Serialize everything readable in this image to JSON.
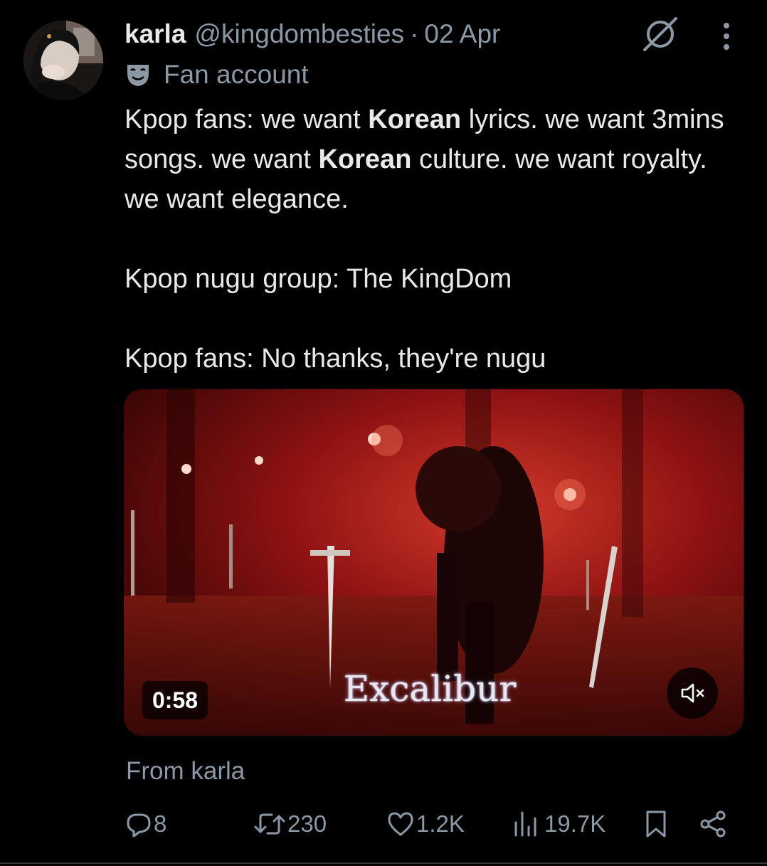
{
  "author": {
    "name": "karla",
    "handle": "@kingdombesties",
    "separator": "·",
    "date": "02 Apr",
    "label": "Fan account"
  },
  "tweet": {
    "line1_a": "Kpop fans: we want ",
    "line1_bold": "Korean",
    "line1_b": " lyrics. we want 3mins songs. we want ",
    "line1_bold2": "Korean",
    "line1_c": " culture. we want royalty. we want elegance.",
    "line2": "Kpop nugu group: The KingDom",
    "line3": "Kpop fans: No thanks, they're nugu"
  },
  "media": {
    "duration": "0:58",
    "caption": "Excalibur",
    "mute_icon": "speaker-muted-icon"
  },
  "from_text": "From karla",
  "actions": {
    "replies": "8",
    "reposts": "230",
    "likes": "1.2K",
    "views": "19.7K"
  },
  "colors": {
    "background": "#000000",
    "text": "#e7e9ea",
    "secondary": "#8b98a5",
    "video_red": "#8e1111"
  }
}
